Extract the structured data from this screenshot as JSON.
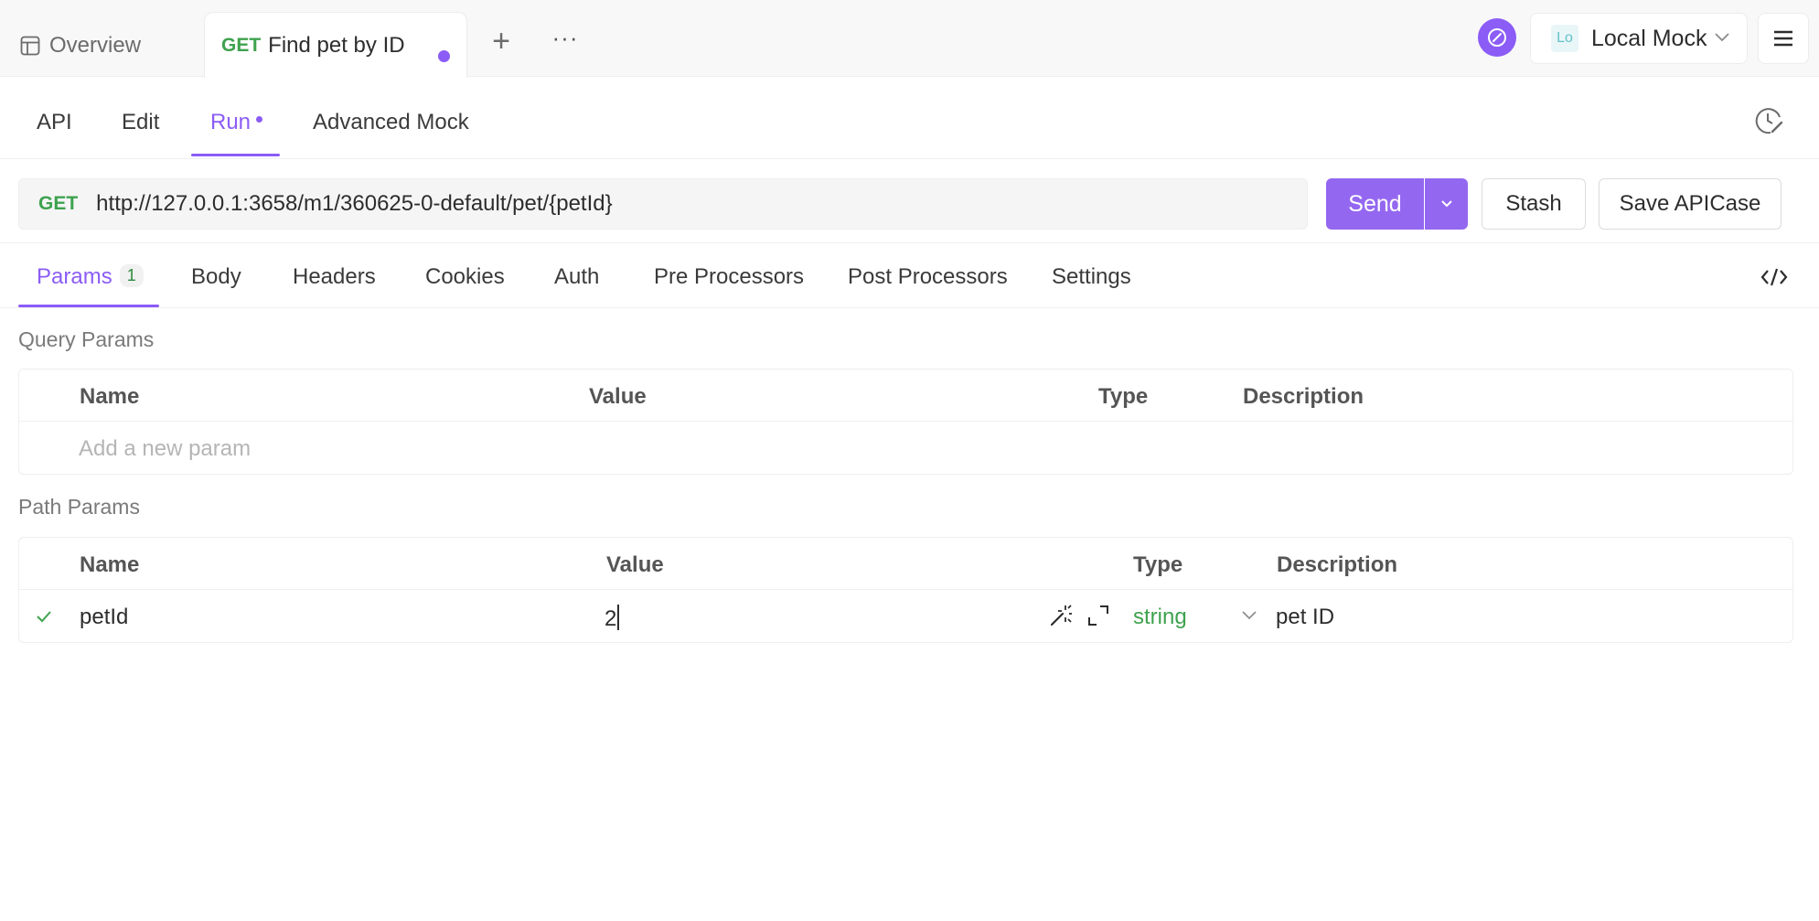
{
  "top_tabs": {
    "overview_label": "Overview",
    "active_tab": {
      "method": "GET",
      "title": "Find pet by ID"
    },
    "environment": {
      "badge": "Lo",
      "label": "Local Mock"
    }
  },
  "sub_tabs": [
    "API",
    "Edit",
    "Run",
    "Advanced Mock"
  ],
  "request": {
    "method": "GET",
    "url": "http://127.0.0.1:3658/m1/360625-0-default/pet/{petId}",
    "send_label": "Send",
    "stash_label": "Stash",
    "save_label": "Save APICase"
  },
  "param_tabs": {
    "params_label": "Params",
    "params_count": "1",
    "others": [
      "Body",
      "Headers",
      "Cookies",
      "Auth",
      "Pre Processors",
      "Post Processors",
      "Settings"
    ]
  },
  "query_params": {
    "title": "Query Params",
    "columns": [
      "Name",
      "Value",
      "Type",
      "Description"
    ],
    "add_placeholder": "Add a new param"
  },
  "path_params": {
    "title": "Path Params",
    "columns": [
      "Name",
      "Value",
      "Type",
      "Description"
    ],
    "rows": [
      {
        "name": "petId",
        "value": "2",
        "type": "string",
        "description": "pet ID"
      }
    ]
  },
  "colors": {
    "accent": "#8b5cf6",
    "method_get": "#3ea24e"
  }
}
